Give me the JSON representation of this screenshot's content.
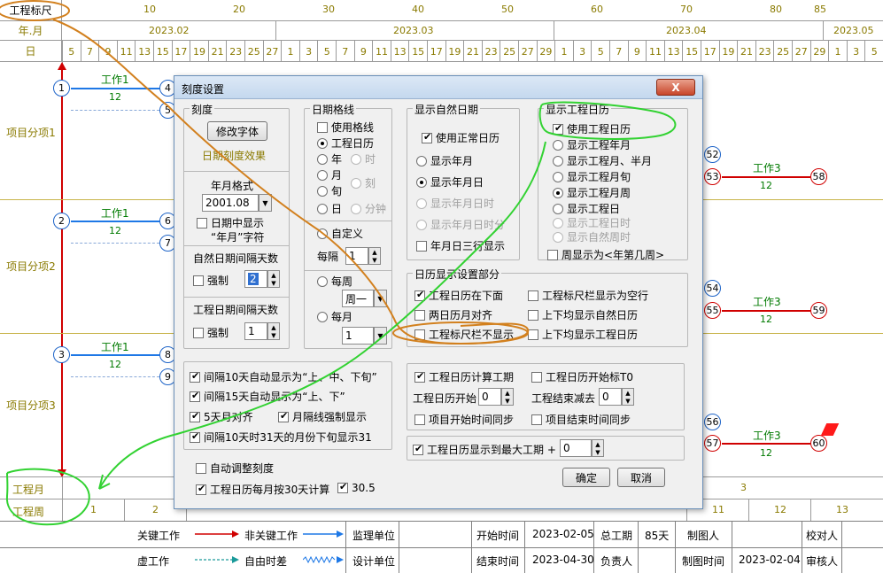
{
  "header": {
    "scale_label": "工程标尺",
    "scale_ticks": [
      "10",
      "20",
      "30",
      "40",
      "50",
      "60",
      "70",
      "80",
      "85"
    ],
    "month_label": "年.月",
    "months": [
      "2023.02",
      "2023.03",
      "2023.04",
      "2023.05"
    ],
    "day_label": "日",
    "days": [
      "5",
      "7",
      "9",
      "11",
      "13",
      "15",
      "17",
      "19",
      "21",
      "23",
      "25",
      "27",
      "1",
      "3",
      "5",
      "7",
      "9",
      "11",
      "13",
      "15",
      "17",
      "19",
      "21",
      "23",
      "25",
      "27",
      "29",
      "1",
      "3",
      "5",
      "7",
      "9",
      "11",
      "13",
      "15",
      "17",
      "19",
      "21",
      "23",
      "25",
      "27",
      "29",
      "1",
      "3",
      "5"
    ]
  },
  "rows": [
    {
      "label": "项目分项1",
      "work_label": "工作1",
      "work_dur": "12",
      "left_nodes": [
        "1",
        "4",
        "5"
      ],
      "right_nodes": [
        "52",
        "53",
        "58"
      ],
      "right_work_label": "工作3",
      "right_work_dur": "12"
    },
    {
      "label": "项目分项2",
      "work_label": "工作1",
      "work_dur": "12",
      "left_nodes": [
        "2",
        "6",
        "7"
      ],
      "right_nodes": [
        "54",
        "55",
        "59"
      ],
      "right_work_label": "工作3",
      "right_work_dur": "12"
    },
    {
      "label": "项目分项3",
      "work_label": "工作1",
      "work_dur": "12",
      "left_nodes": [
        "3",
        "8",
        "9"
      ],
      "right_nodes": [
        "56",
        "57",
        "60"
      ],
      "right_work_label": "工作3",
      "right_work_dur": "12"
    }
  ],
  "bottom_axis": {
    "month_label": "工程月",
    "month_visible": "3",
    "week_label": "工程周",
    "weeks": [
      "1",
      "2",
      "11",
      "12",
      "13"
    ]
  },
  "footer": {
    "critical_work": "关键工作",
    "noncritical_work": "非关键工作",
    "dummy_work": "虚工作",
    "free_float": "自由时差",
    "supervisor": "监理单位",
    "designer": "设计单位",
    "start_time_label": "开始时间",
    "start_time": "2023-02-05",
    "end_time_label": "结束时间",
    "end_time": "2023-04-30",
    "total_duration_label": "总工期",
    "total_duration": "85天",
    "responsible_label": "负责人",
    "drafter_label": "制图人",
    "drafting_time_label": "制图时间",
    "drafting_time": "2023-02-04",
    "checker_label": "校对人",
    "reviewer_label": "审核人"
  },
  "dialog": {
    "title": "刻度设置",
    "close_label": "X",
    "scale_group": {
      "title": "刻度",
      "font_button": "修改字体",
      "preview": "日期刻度效果",
      "year_month_format_label": "年月格式",
      "year_month_format_value": "2001.08",
      "show_year_month_in_date_line1": "日期中显示",
      "show_year_month_in_date_line2": "“年月”字符",
      "natural_interval_label": "自然日期间隔天数",
      "natural_force_label": "强制",
      "natural_interval_value": "2",
      "project_interval_label": "工程日期间隔天数",
      "project_force_label": "强制",
      "project_interval_value": "1"
    },
    "date_grid_group": {
      "title": "日期格线",
      "use_grid": "使用格线",
      "project_calendar": "工程日历",
      "year": "年",
      "hour": "时",
      "month": "月",
      "quarter": "刻",
      "dekad": "旬",
      "day": "日",
      "minute": "分钟",
      "custom": "自定义",
      "every_label": "每隔",
      "every_value": "1",
      "weekly": "每周",
      "weekday_value": "周一",
      "monthly": "每月",
      "month_day_value": "1"
    },
    "natural_date_group": {
      "title": "显示自然日期",
      "use_normal_calendar": "使用正常日历",
      "show_ym": "显示年月",
      "show_ymd": "显示年月日",
      "show_ymdh": "显示年月日时",
      "show_ymdhm": "显示年月日时分",
      "three_lines": "年月日三行显示"
    },
    "project_calendar_group": {
      "title": "显示工程日历",
      "use_project_calendar": "使用工程日历",
      "show_pym": "显示工程年月",
      "show_pmhalf": "显示工程月、半月",
      "show_pdekad": "显示工程月旬",
      "show_pweek": "显示工程月周",
      "show_pday": "显示工程日",
      "show_phour": "显示工程日时",
      "show_nweekhour": "显示自然周时",
      "week_as_year_week": "周显示为<年第几周>"
    },
    "calendar_display_group": {
      "title": "日历显示设置部分",
      "project_calendar_below": "工程日历在下面",
      "ruler_show_empty_row": "工程标尺栏显示为空行",
      "two_calendar_align": "两日历月对齐",
      "both_show_natural": "上下均显示自然日历",
      "ruler_not_shown": "工程标尺栏不显示",
      "both_show_project": "上下均显示工程日历"
    },
    "bottom_left_options": {
      "ten_day_auto": "间隔10天自动显示为“上、中、下旬”",
      "fifteen_day_auto": "间隔15天自动显示为“上、下”",
      "five_day_align": "5天月对齐",
      "month_line_force": "月隔线强制显示",
      "ten_day_31": "间隔10天时31天的月份下旬显示31"
    },
    "calc_group": {
      "calc_duration": "工程日历计算工期",
      "start_t0": "工程日历开始标T0",
      "start_label": "工程日历开始",
      "start_value": "0",
      "end_minus_label": "工程结束减去",
      "end_minus_value": "0",
      "start_sync": "项目开始时间同步",
      "end_sync": "项目结束时间同步"
    },
    "max_duration": {
      "label": "工程日历显示到最大工期 +",
      "value": "0"
    },
    "auto_adjust": "自动调整刻度",
    "month_30_days": "工程日历每月按30天计算",
    "month_30_value": "30.5",
    "ok_button": "确定",
    "cancel_button": "取消"
  },
  "colors": {
    "critical": "#d00000",
    "noncritical": "#1e78e6",
    "free_float": "#1a9a9a",
    "annotation_orange": "#d2801e",
    "annotation_green": "#32d232",
    "row_label": "#8a7a00"
  }
}
